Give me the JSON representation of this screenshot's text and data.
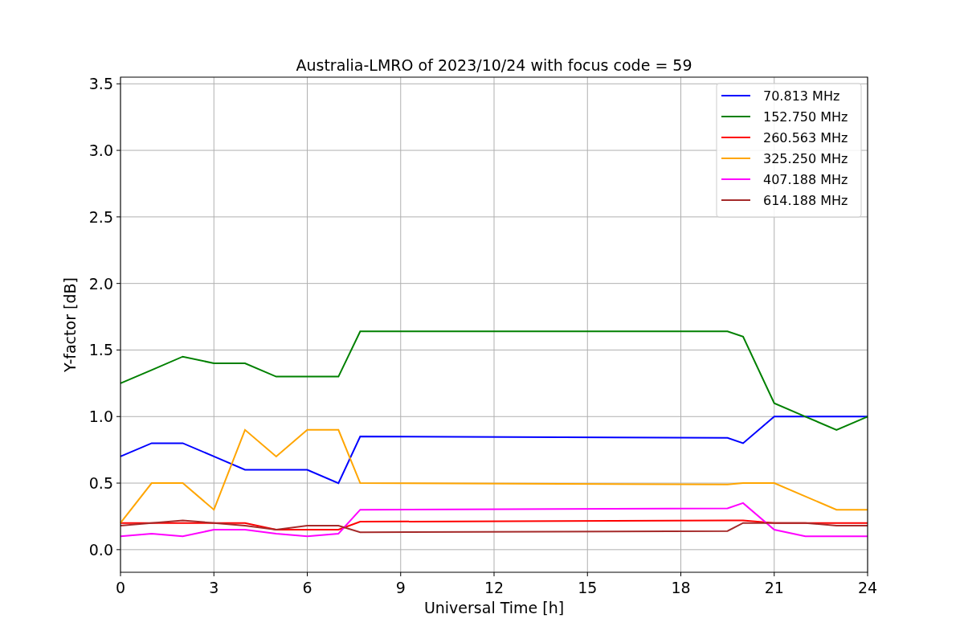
{
  "chart_data": {
    "type": "line",
    "title": "Australia-LMRO of 2023/10/24 with focus code = 59",
    "xlabel": "Universal Time [h]",
    "ylabel": "Y-factor [dB]",
    "x": [
      0,
      1,
      2,
      3,
      4,
      5,
      6,
      7,
      7.7,
      19.5,
      20,
      21,
      22,
      23,
      24
    ],
    "grid": true,
    "legend": true,
    "xlim": [
      0,
      24
    ],
    "ylim": [
      -0.17,
      3.55
    ],
    "xticks": [
      0,
      3,
      6,
      9,
      12,
      15,
      18,
      21,
      24
    ],
    "yticks": [
      {
        "value": 0,
        "label": "0.0"
      },
      {
        "value": 0.5,
        "label": "0.5"
      },
      {
        "value": 1,
        "label": "1.0"
      },
      {
        "value": 1.5,
        "label": "1.5"
      },
      {
        "value": 2,
        "label": "2.0"
      },
      {
        "value": 2.5,
        "label": "2.5"
      },
      {
        "value": 3,
        "label": "3.0"
      },
      {
        "value": 3.5,
        "label": "3.5"
      }
    ],
    "series": [
      {
        "name": "70.813 MHz",
        "color": "#0000ff",
        "values": [
          0.7,
          0.8,
          0.8,
          0.7,
          0.6,
          0.6,
          0.6,
          0.5,
          0.85,
          0.84,
          0.8,
          1.0,
          1.0,
          1.0,
          1.0
        ]
      },
      {
        "name": "152.750 MHz",
        "color": "#008000",
        "values": [
          1.25,
          1.35,
          1.45,
          1.4,
          1.4,
          1.3,
          1.3,
          1.3,
          1.64,
          1.64,
          1.6,
          1.1,
          1.0,
          0.9,
          1.0
        ]
      },
      {
        "name": "260.563 MHz",
        "color": "#ff0000",
        "values": [
          0.2,
          0.2,
          0.2,
          0.2,
          0.2,
          0.15,
          0.15,
          0.15,
          0.21,
          0.22,
          0.22,
          0.2,
          0.2,
          0.2,
          0.2
        ]
      },
      {
        "name": "325.250 MHz",
        "color": "#ffa500",
        "values": [
          0.2,
          0.5,
          0.5,
          0.3,
          0.9,
          0.7,
          0.9,
          0.9,
          0.5,
          0.49,
          0.5,
          0.5,
          0.4,
          0.3,
          0.3
        ]
      },
      {
        "name": "407.188 MHz",
        "color": "#ff00ff",
        "values": [
          0.1,
          0.12,
          0.1,
          0.15,
          0.15,
          0.12,
          0.1,
          0.12,
          0.3,
          0.31,
          0.35,
          0.15,
          0.1,
          0.1,
          0.1
        ]
      },
      {
        "name": "614.188 MHz",
        "color": "#a52a2a",
        "values": [
          0.18,
          0.2,
          0.22,
          0.2,
          0.18,
          0.15,
          0.18,
          0.18,
          0.13,
          0.14,
          0.2,
          0.2,
          0.2,
          0.18,
          0.18
        ]
      }
    ]
  }
}
